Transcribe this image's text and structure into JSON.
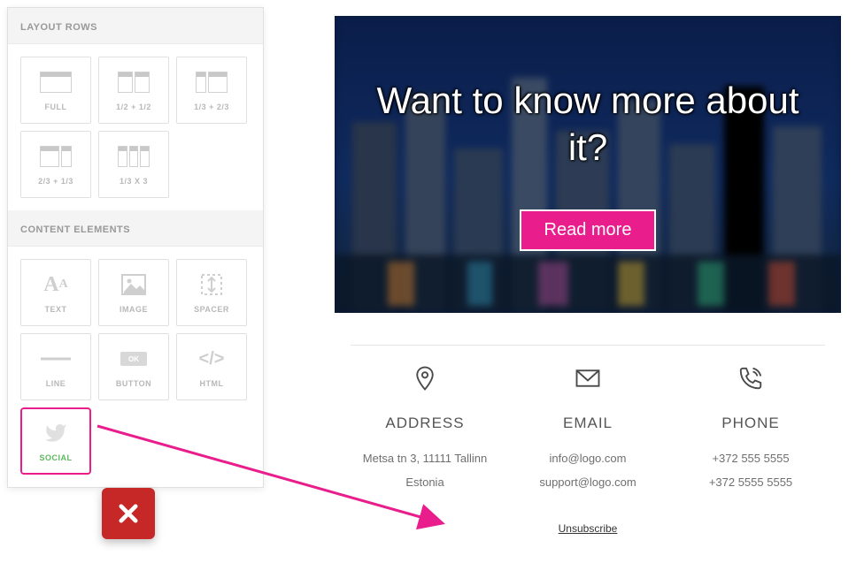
{
  "sidebar": {
    "layout_header": "LAYOUT ROWS",
    "layout_tiles": [
      {
        "label": "FULL"
      },
      {
        "label": "1/2 + 1/2"
      },
      {
        "label": "1/3 + 2/3"
      },
      {
        "label": "2/3 + 1/3"
      },
      {
        "label": "1/3 X 3"
      }
    ],
    "content_header": "CONTENT ELEMENTS",
    "content_tiles": [
      {
        "label": "TEXT"
      },
      {
        "label": "IMAGE"
      },
      {
        "label": "SPACER"
      },
      {
        "label": "LINE"
      },
      {
        "label": "BUTTON"
      },
      {
        "label": "HTML"
      },
      {
        "label": "SOCIAL"
      }
    ]
  },
  "preview": {
    "hero_title": "Want to know more about it?",
    "cta_label": "Read more",
    "contacts": [
      {
        "heading": "ADDRESS",
        "lines": [
          "Metsa tn 3, 11111 Tallinn",
          "Estonia"
        ]
      },
      {
        "heading": "EMAIL",
        "lines": [
          "info@logo.com",
          "support@logo.com"
        ]
      },
      {
        "heading": "PHONE",
        "lines": [
          "+372 555 5555",
          "+372 5555 5555"
        ]
      }
    ],
    "unsubscribe": "Unsubscribe"
  },
  "colors": {
    "accent": "#e91e8c",
    "danger": "#c62828",
    "success": "#5cb85c"
  }
}
